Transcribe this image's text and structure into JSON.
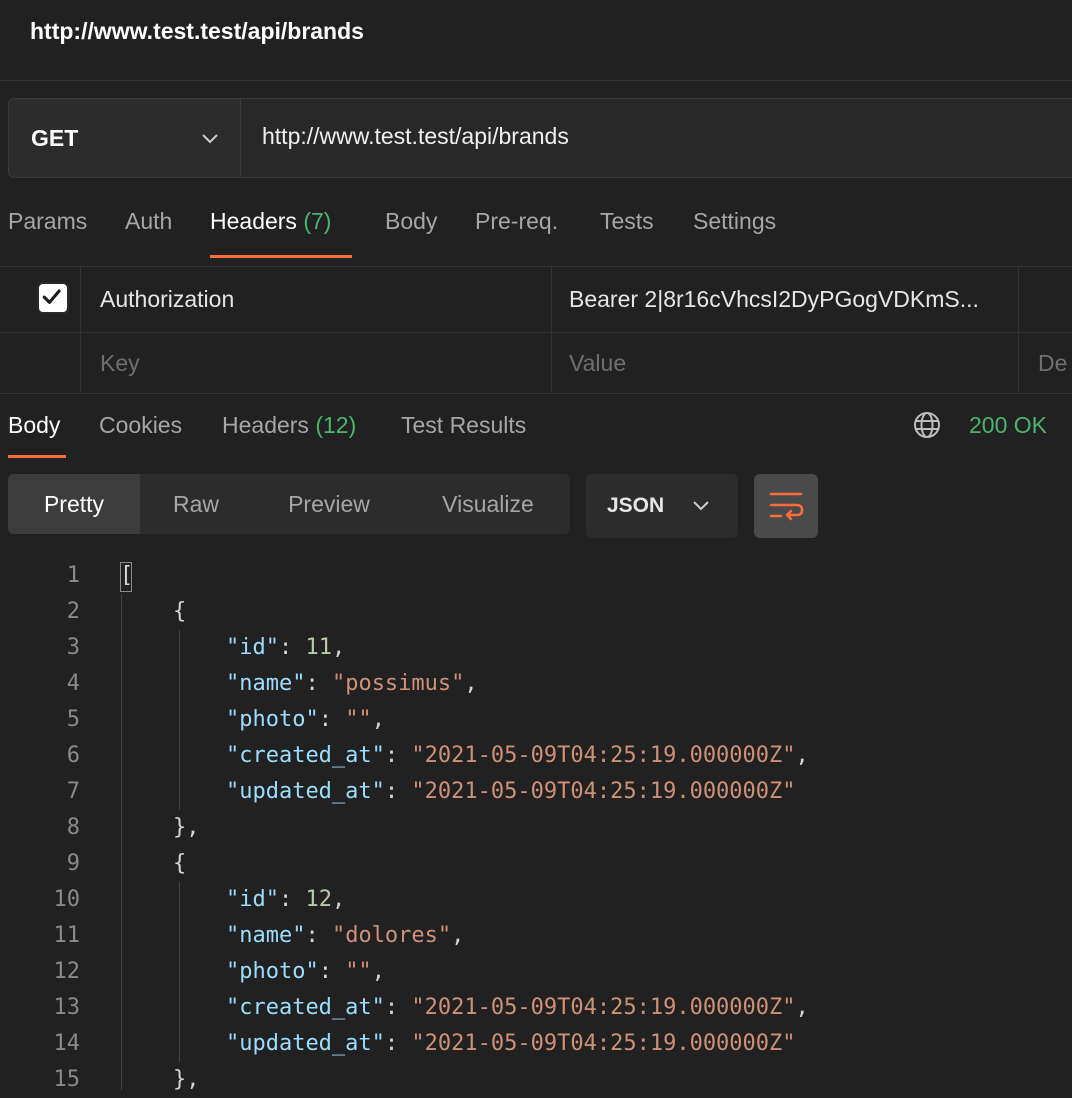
{
  "window": {
    "tab_title": "http://www.test.test/api/brands"
  },
  "request": {
    "method": "GET",
    "url": "http://www.test.test/api/brands",
    "tabs": [
      {
        "label": "Params",
        "count": ""
      },
      {
        "label": "Auth",
        "count": ""
      },
      {
        "label": "Headers",
        "count": "(7)"
      },
      {
        "label": "Body",
        "count": ""
      },
      {
        "label": "Pre-req.",
        "count": ""
      },
      {
        "label": "Tests",
        "count": ""
      },
      {
        "label": "Settings",
        "count": ""
      }
    ],
    "active_tab": "Headers"
  },
  "headers_table": {
    "rows": [
      {
        "checked": true,
        "key": "Authorization",
        "value": "Bearer 2|8r16cVhcsI2DyPGogVDKmS..."
      }
    ],
    "new_row": {
      "key_placeholder": "Key",
      "value_placeholder": "Value",
      "description_placeholder": "De"
    }
  },
  "response": {
    "tabs": [
      {
        "label": "Body",
        "count": ""
      },
      {
        "label": "Cookies",
        "count": ""
      },
      {
        "label": "Headers",
        "count": "(12)"
      },
      {
        "label": "Test Results",
        "count": ""
      }
    ],
    "active_tab": "Body",
    "status": "200 OK",
    "view_modes": [
      "Pretty",
      "Raw",
      "Preview",
      "Visualize"
    ],
    "active_view": "Pretty",
    "format": "JSON"
  },
  "body_lines": [
    {
      "n": "1",
      "text": "["
    },
    {
      "n": "2",
      "text": "    {"
    },
    {
      "n": "3",
      "text": "        \"id\": 11,"
    },
    {
      "n": "4",
      "text": "        \"name\": \"possimus\","
    },
    {
      "n": "5",
      "text": "        \"photo\": \"\","
    },
    {
      "n": "6",
      "text": "        \"created_at\": \"2021-05-09T04:25:19.000000Z\","
    },
    {
      "n": "7",
      "text": "        \"updated_at\": \"2021-05-09T04:25:19.000000Z\""
    },
    {
      "n": "8",
      "text": "    },"
    },
    {
      "n": "9",
      "text": "    {"
    },
    {
      "n": "10",
      "text": "        \"id\": 12,"
    },
    {
      "n": "11",
      "text": "        \"name\": \"dolores\","
    },
    {
      "n": "12",
      "text": "        \"photo\": \"\","
    },
    {
      "n": "13",
      "text": "        \"created_at\": \"2021-05-09T04:25:19.000000Z\","
    },
    {
      "n": "14",
      "text": "        \"updated_at\": \"2021-05-09T04:25:19.000000Z\""
    },
    {
      "n": "15",
      "text": "    },"
    }
  ],
  "colors": {
    "accent": "#ff6c37",
    "success": "#4ab56b",
    "json_key": "#9cdcfe",
    "json_string": "#ce9178",
    "json_number": "#b5cea8"
  },
  "icons": {
    "method_dropdown": "chevron-down-icon",
    "checkbox": "check-icon",
    "globe": "globe-icon",
    "format_dropdown": "chevron-down-icon",
    "wrap": "wrap-lines-icon"
  }
}
